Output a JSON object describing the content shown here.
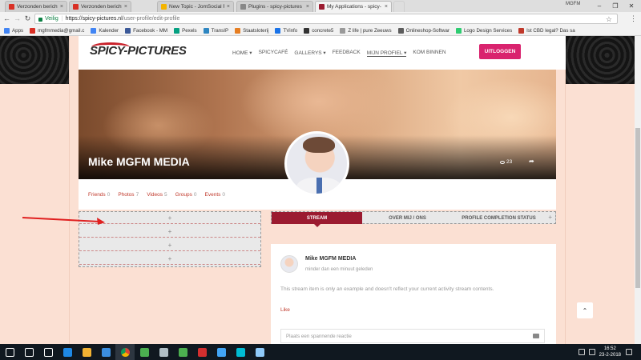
{
  "browser": {
    "tabs": [
      {
        "label": "Verzonden berichten - m",
        "color": "#d93025",
        "active": false
      },
      {
        "label": "Verzonden berichten - m",
        "color": "#d93025",
        "active": false
      },
      {
        "label": "New Topic - JomSocial F",
        "color": "#f4b400",
        "active": false
      },
      {
        "label": "Plugins - spicy-pictures",
        "color": "#888888",
        "active": false
      },
      {
        "label": "My Applications - spicy-",
        "color": "#9b1b30",
        "active": true
      }
    ],
    "profile_name": "MGFM",
    "window_controls": [
      "–",
      "❐",
      "✕"
    ],
    "nav": {
      "back": "←",
      "forward": "→",
      "reload": "↻"
    },
    "secure_label": "Veilig",
    "url_host": "https://spicy-pictures.nl",
    "url_path": "/user-profile/edit-profile",
    "star_icon": "☆",
    "bookmarks": [
      {
        "label": "Apps",
        "color": "#4285f4"
      },
      {
        "label": "mgfmmedia@gmail.c",
        "color": "#d93025"
      },
      {
        "label": "Kalender",
        "color": "#4285f4"
      },
      {
        "label": "Facebook - MM",
        "color": "#3b5998"
      },
      {
        "label": "Pexels",
        "color": "#05a081"
      },
      {
        "label": "TransIP",
        "color": "#2e86c1"
      },
      {
        "label": "Staatsloterij",
        "color": "#e67e22"
      },
      {
        "label": "TVinfo",
        "color": "#1a73e8"
      },
      {
        "label": "concrete5",
        "color": "#333333"
      },
      {
        "label": "Z life | pure Zeeuws",
        "color": "#999999"
      },
      {
        "label": "Onlineshop-Softwar",
        "color": "#5c5c5c"
      },
      {
        "label": "Logo Design Services",
        "color": "#2ecc71"
      },
      {
        "label": "Ist CBD legal? Das sa",
        "color": "#c0392b"
      }
    ]
  },
  "site": {
    "logo": "SPICY-PICTURES",
    "menu": [
      "HOME ▾",
      "SPICYCAFÉ",
      "GALLERYS ▾",
      "FEEDBACK",
      "MIJN PROFIEL ▾",
      "KOM BINNEN"
    ],
    "logout_label": "UITLOGGEN",
    "accent": "#d9236e"
  },
  "profile": {
    "name": "Mike MGFM MEDIA",
    "views": "23",
    "share_icon": "➦",
    "stats": [
      {
        "label": "Friends",
        "count": "0"
      },
      {
        "label": "Photos",
        "count": "7"
      },
      {
        "label": "Videos",
        "count": "5"
      },
      {
        "label": "Groups",
        "count": "0"
      },
      {
        "label": "Events",
        "count": "0"
      }
    ]
  },
  "widget_rows": [
    "+",
    "+",
    "+",
    "+"
  ],
  "profile_tabs": [
    {
      "label": "STREAM",
      "active": true
    },
    {
      "label": "OVER MIJ / ONS",
      "active": false
    },
    {
      "label": "PROFILE COMPLETION STATUS",
      "active": false
    }
  ],
  "tab_plus": "+",
  "stream": {
    "author": "Mike MGFM MEDIA",
    "time": "minder dan een minuut geleden",
    "text": "This stream item is only an example and doesn't reflect your current activity stream contents.",
    "like": "Like",
    "comment_placeholder": "Plaats een spannende reactie"
  },
  "back_to_top_icon": "⌃",
  "taskbar": {
    "time": "16:52",
    "date": "23-2-2018",
    "icons": [
      "#ffffff",
      "#ffffff",
      "#ffffff",
      "#1e88e5",
      "#f2b233",
      "#3b8ee0",
      "#e9e9e9",
      "#4caf50",
      "#b0bec5",
      "#4caf50",
      "#d32f2f",
      "#42a5f5",
      "#00bcd4",
      "#90caf9"
    ]
  }
}
